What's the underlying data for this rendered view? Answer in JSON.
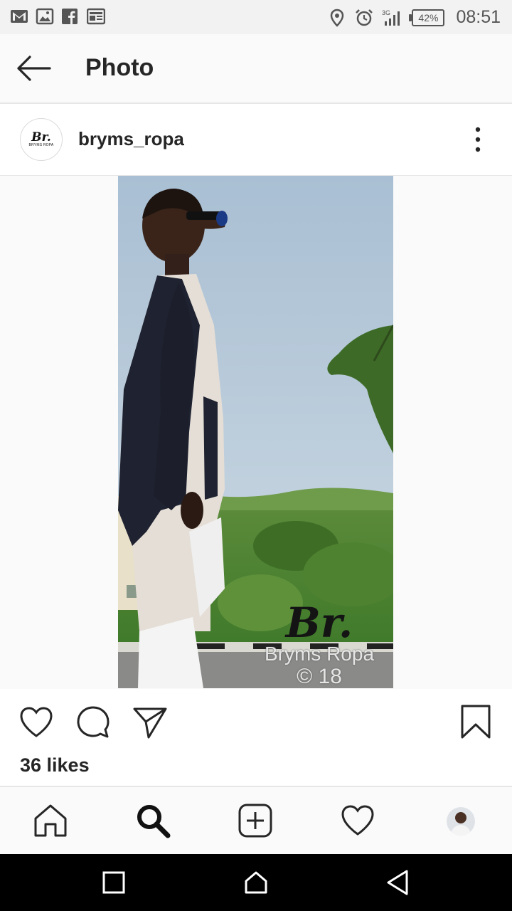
{
  "status_bar": {
    "left_icons": [
      "gmail-icon",
      "gallery-icon",
      "facebook-icon",
      "news-icon"
    ],
    "right_icons": [
      "location-icon",
      "alarm-icon",
      "signal-icon"
    ],
    "network": "3G",
    "battery": "42%",
    "time": "08:51"
  },
  "header": {
    "title": "Photo",
    "back_icon": "arrow-left-icon"
  },
  "post": {
    "avatar_mark": "Br.",
    "avatar_sub": "BRYMS ROPA",
    "username": "bryms_ropa",
    "more_icon": "more-vertical-icon",
    "watermark": {
      "mark": "Br.",
      "brand": "Bryms Ropa",
      "copyright": "© 18"
    },
    "likes": "36 likes"
  },
  "actions": [
    "heart-icon",
    "comment-icon",
    "share-icon",
    "bookmark-icon"
  ],
  "bottom_nav": [
    "home-icon",
    "search-icon",
    "add-icon",
    "activity-icon",
    "profile-avatar"
  ],
  "system_nav": [
    "recents-icon",
    "home-icon",
    "back-icon"
  ],
  "colors": {
    "text": "#262626",
    "bg": "#fafafa",
    "divider": "#e6e6e6",
    "system_bar": "#000000"
  }
}
